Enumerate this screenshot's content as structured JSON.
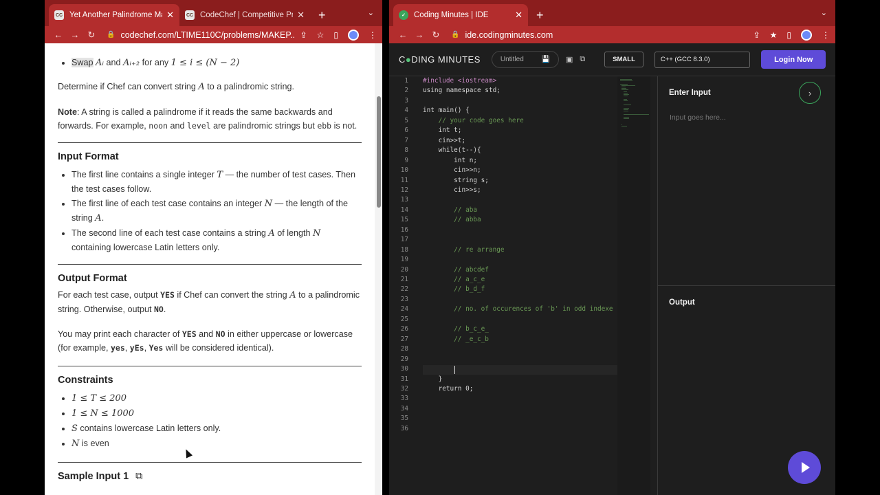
{
  "left_window": {
    "tabs": [
      {
        "title": "Yet Another Palindrome Makin",
        "favicon": "CC",
        "active": true
      },
      {
        "title": "CodeChef | Competitive Progr",
        "favicon": "CC",
        "active": false
      }
    ],
    "new_tab": "+",
    "url": "codechef.com/LTIME110C/problems/MAKEP..."
  },
  "problem": {
    "swap_prefix": "Swap",
    "swap_a1": "Aᵢ",
    "swap_and": "and",
    "swap_a2": "Aᵢ₊₂",
    "swap_mid": "for any",
    "swap_cond": "1 ≤ i ≤ (N − 2)",
    "determine": "Determine if Chef can convert string",
    "determine_var": "A",
    "determine_end": "to a palindromic string.",
    "note_label": "Note",
    "note_text1": ": A string is called a palindrome if it reads the same backwards and forwards. For example,",
    "note_noon": "noon",
    "note_and": "and",
    "note_level": "level",
    "note_text2": "are palindromic strings but",
    "note_ebb": "ebb",
    "note_end": "is not.",
    "input_title": "Input Format",
    "input_items": [
      {
        "pre": "The first line contains a single integer",
        "var": "T",
        "post": "— the number of test cases. Then the test cases follow."
      },
      {
        "pre": "The first line of each test case contains an integer",
        "var": "N",
        "post": "— the length of the string",
        "var2": "A",
        "post2": "."
      },
      {
        "pre": "The second line of each test case contains a string",
        "var": "A",
        "post": "of length",
        "var2": "N",
        "post2": "containing lowercase Latin letters only."
      }
    ],
    "output_title": "Output Format",
    "output_p1_a": "For each test case, output",
    "output_yes": "YES",
    "output_p1_b": "if Chef can convert the string",
    "output_var": "A",
    "output_p1_c": "to a palindromic string. Otherwise, output",
    "output_no": "NO",
    "output_p1_d": ".",
    "output_p2_a": "You may print each character of",
    "output_p2_yes": "YES",
    "output_p2_and": "and",
    "output_p2_no": "NO",
    "output_p2_b": "in either uppercase or lowercase (for example,",
    "output_ex1": "yes",
    "output_ex2": "yEs",
    "output_ex3": "Yes",
    "output_p2_c": "will be considered identical).",
    "constraints_title": "Constraints",
    "constraints": [
      {
        "math": "1 ≤ T ≤ 200",
        "text": ""
      },
      {
        "math": "1 ≤ N ≤ 1000",
        "text": ""
      },
      {
        "math": "S",
        "text": "contains lowercase Latin letters only."
      },
      {
        "math": "N",
        "text": "is even"
      }
    ],
    "sample_title": "Sample Input 1"
  },
  "right_window": {
    "tabs": [
      {
        "title": "Coding Minutes | IDE",
        "active": true
      }
    ],
    "new_tab": "+",
    "url": "ide.codingminutes.com"
  },
  "ide": {
    "logo_pre": "C",
    "logo_o": "●",
    "logo_post": "DING MINUTES",
    "file_name": "Untitled",
    "size_button": "SMALL",
    "language": "C++ (GCC 8.3.0)",
    "login_button": "Login Now",
    "input_title": "Enter Input",
    "input_placeholder": "Input goes here...",
    "output_title": "Output",
    "code_lines": [
      "#include <iostream>",
      "using namespace std;",
      "",
      "int main() {",
      "    // your code goes here",
      "    int t;",
      "    cin>>t;",
      "    while(t--){",
      "        int n;",
      "        cin>>n;",
      "        string s;",
      "        cin>>s;",
      "",
      "        // aba",
      "        // abba",
      "",
      "",
      "        // re arrange",
      "",
      "        // abcdef",
      "        // a_c_e",
      "        // b_d_f",
      "",
      "        // no. of occurences of 'b' in odd indexe",
      "",
      "        // b_c_e_",
      "        // _e_c_b",
      "",
      "        ",
      "",
      "    }",
      "    return 0;",
      "",
      "",
      ""
    ],
    "line_numbers": [
      "1",
      "2",
      "3",
      "4",
      "5",
      "6",
      "7",
      "8",
      "9",
      "10",
      "11",
      "12",
      "13",
      "14",
      "15",
      "16",
      "17",
      "18",
      "19",
      "20",
      "21",
      "22",
      "23",
      "24",
      "25",
      "26",
      "27",
      "28",
      "29",
      "30",
      "31",
      "32",
      "33",
      "34",
      "35",
      "36"
    ],
    "current_line": 30
  }
}
